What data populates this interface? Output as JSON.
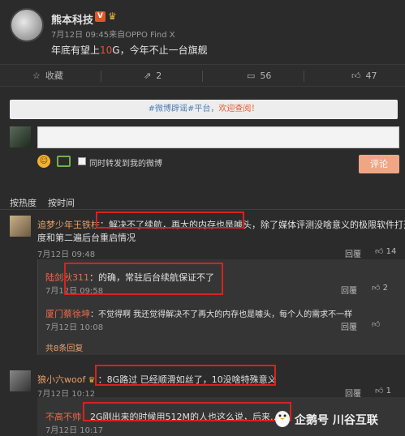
{
  "post": {
    "author": "熊本科技",
    "v_badge": "V",
    "meta": "7月12日 09:45来自OPPO Find X",
    "text_pre": "年底有望上",
    "text_hl": "10",
    "text_post": "G，今年不止一台旗舰"
  },
  "actions": {
    "favorite": "收藏",
    "repost_count": "2",
    "comment_count": "56",
    "like_count": "47"
  },
  "notice": {
    "link": "#微博辟谣#平台",
    "sep": "，",
    "link2": "欢迎查阅！"
  },
  "composer": {
    "repost_label": "同时转发到我的微博",
    "submit_label": "评论"
  },
  "sort": {
    "hot": "按热度",
    "time": "按时间"
  },
  "comments": [
    {
      "user": "追梦少年王铁柱",
      "text_boxed": "：解决不了续航，再大的内存也是噱头",
      "text_rest": "，除了媒体评测没啥意义的极限软件打开速",
      "text_line2": "度和第二遍后台重启情况",
      "time": "7月12日 09:48",
      "reply": "回覆",
      "likes": "14"
    },
    {
      "user": "陆剑秋311",
      "text": "：的确，常驻后台续航保证不了",
      "time": "7月12日 09:58",
      "reply": "回覆",
      "likes": "2"
    },
    {
      "user": "厦门蔡徐坤",
      "text": "：不觉得啊 我还觉得解决不了再大的内存也是噱头，每个人的需求不一样",
      "time": "7月12日 10:08",
      "reply": "回覆",
      "likes": ""
    },
    {
      "more": "共8条回复"
    },
    {
      "user": "狼小六woof",
      "text": "：8G路过  已经顺滑如丝了，10没啥特殊意义",
      "time": "7月12日 10:12",
      "reply": "回覆",
      "likes": "1"
    },
    {
      "user": "不高不帅",
      "text": "：2G刚出来的时候用512M的人也这么说，后来……",
      "time": "7月12日 10:17"
    }
  ],
  "watermark": {
    "text": "企鹅号 川谷互联"
  },
  "colors": {
    "background": "#2b2b2b",
    "username": "#e8a06a",
    "highlight": "#e0533a",
    "annotation_box": "#d8221e",
    "submit": "#f0a585"
  }
}
